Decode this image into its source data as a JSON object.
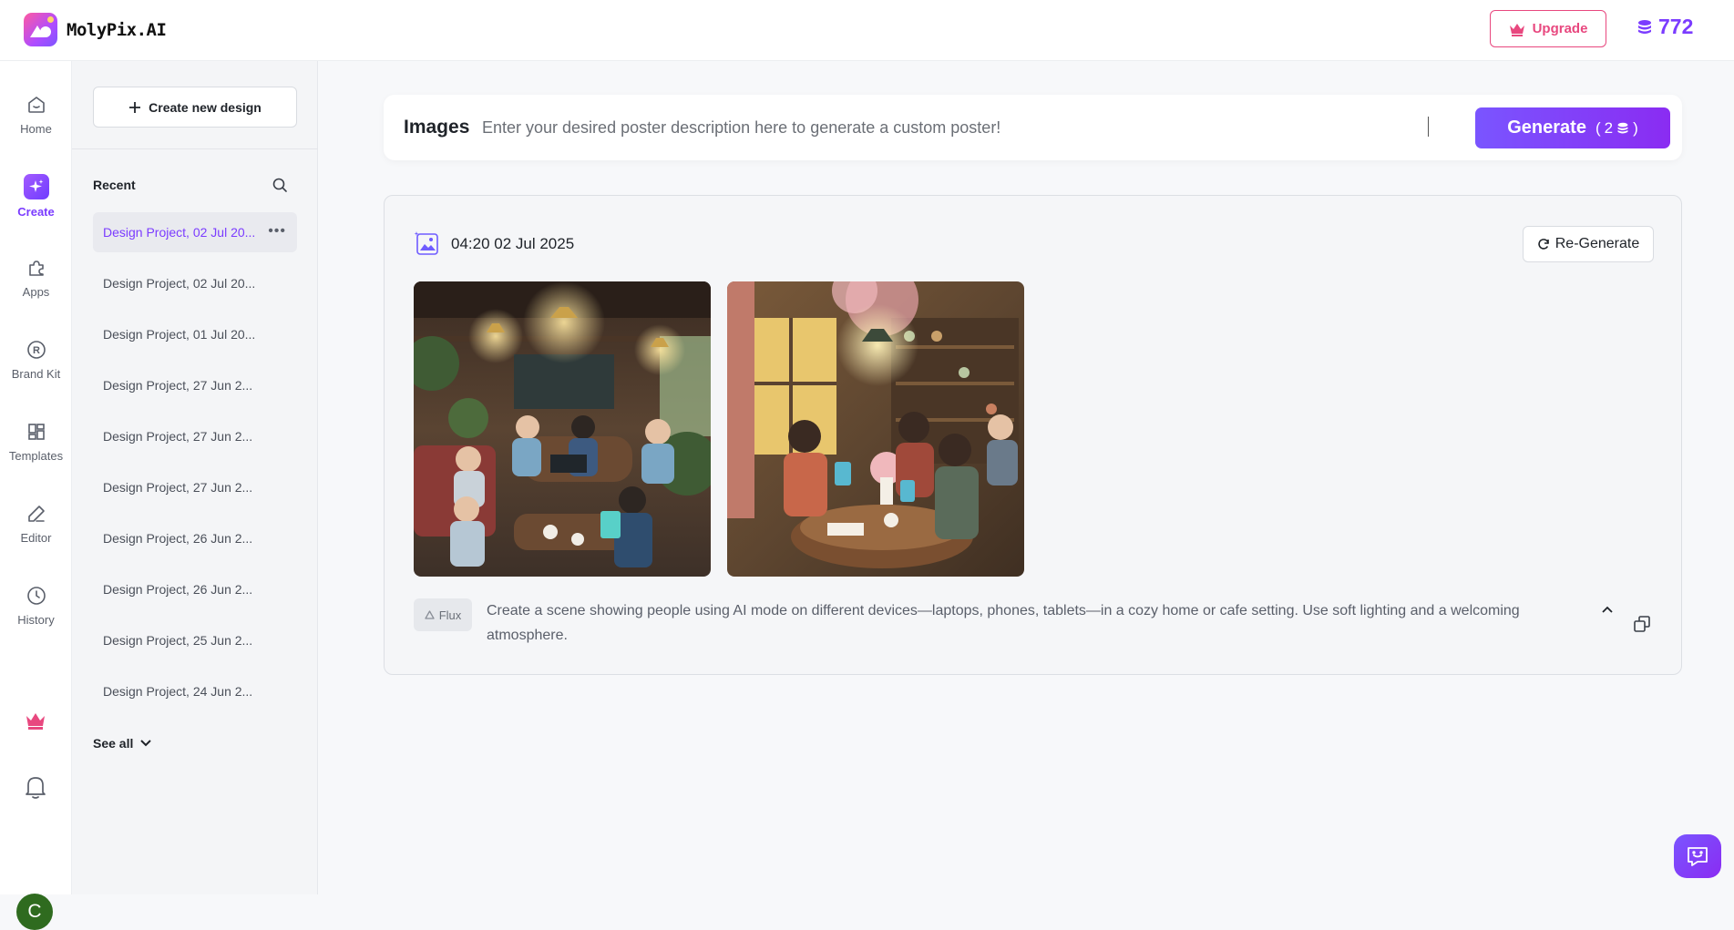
{
  "app": {
    "name": "MolyPix.AI",
    "upgrade_label": "Upgrade",
    "credits": "772"
  },
  "rail": {
    "items": [
      {
        "label": "Home",
        "icon": "home-icon"
      },
      {
        "label": "Create",
        "icon": "sparkle-icon",
        "active": true
      },
      {
        "label": "Apps",
        "icon": "puzzle-icon"
      },
      {
        "label": "Brand Kit",
        "icon": "registered-icon"
      },
      {
        "label": "Templates",
        "icon": "grid-icon"
      },
      {
        "label": "Editor",
        "icon": "pencil-icon"
      },
      {
        "label": "History",
        "icon": "clock-icon"
      }
    ],
    "avatar_initial": "C"
  },
  "sidebar": {
    "create_new_label": "Create new design",
    "recent_label": "Recent",
    "projects": [
      "Design Project, 02 Jul 20...",
      "Design Project, 02 Jul 20...",
      "Design Project, 01 Jul 20...",
      "Design Project, 27 Jun 2...",
      "Design Project, 27 Jun 2...",
      "Design Project, 27 Jun 2...",
      "Design Project, 26 Jun 2...",
      "Design Project, 26 Jun 2...",
      "Design Project, 25 Jun 2...",
      "Design Project, 24 Jun 2..."
    ],
    "see_all_label": "See all"
  },
  "prompt": {
    "label": "Images",
    "placeholder": "Enter your desired poster description here to generate a custom poster!",
    "generate_label": "Generate",
    "generate_cost": "2"
  },
  "result": {
    "timestamp": "04:20 02 Jul 2025",
    "regenerate_label": "Re-Generate",
    "model": "Flux",
    "prompt_text": "Create a scene showing people using AI mode on different devices—laptops, phones, tablets—in a cozy home or cafe setting. Use soft lighting and a welcoming atmosphere."
  }
}
